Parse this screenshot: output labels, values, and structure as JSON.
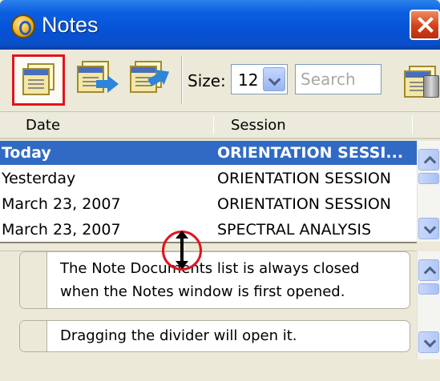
{
  "window": {
    "title": "Notes"
  },
  "toolbar": {
    "size_label": "Size:",
    "size_value": "12",
    "search_placeholder": "Search"
  },
  "table": {
    "columns": [
      "Date",
      "Session"
    ],
    "rows": [
      {
        "date": "Today",
        "session": "ORIENTATION SESSI...",
        "selected": true
      },
      {
        "date": "Yesterday",
        "session": "ORIENTATION SESSION"
      },
      {
        "date": "March 23, 2007",
        "session": "ORIENTATION SESSION"
      },
      {
        "date": "March 23, 2007",
        "session": "SPECTRAL ANALYSIS"
      }
    ]
  },
  "notes": [
    {
      "text": "The Note Documents list is always closed when the Notes window is first opened."
    },
    {
      "text": "Dragging the divider will open it."
    }
  ],
  "colors": {
    "selection": "#316ac5",
    "highlight": "#e0141e",
    "titlebar": "#0552d6"
  }
}
